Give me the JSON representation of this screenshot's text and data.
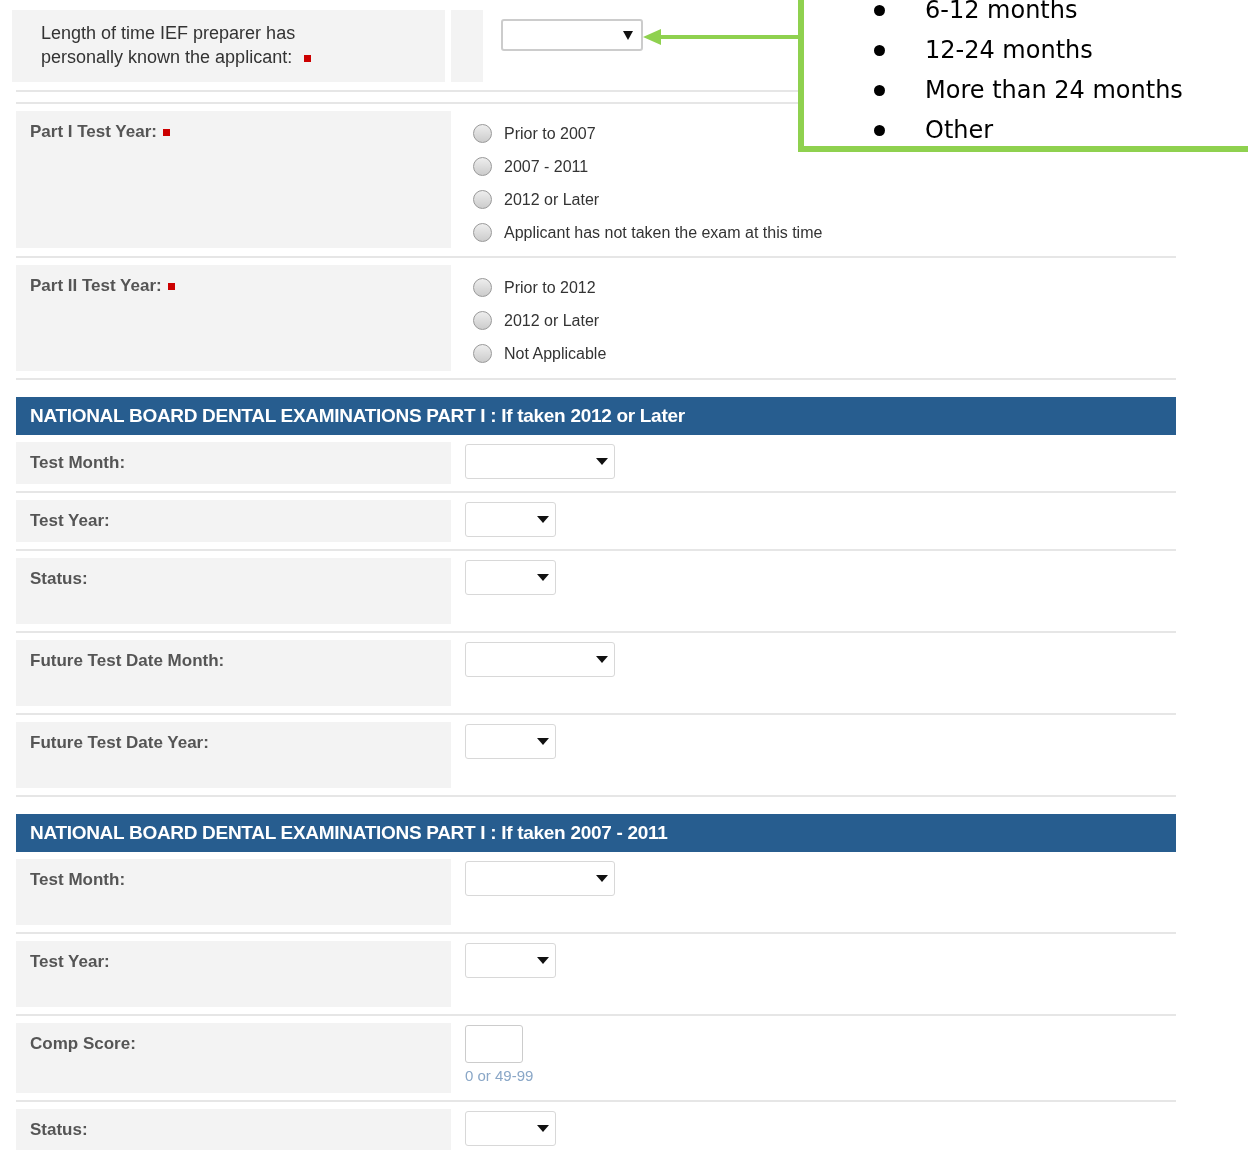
{
  "top_question": {
    "label": "Length of time IEF preparer has personally known the applicant:",
    "required": true
  },
  "callout": {
    "items": [
      "6-12 months",
      "12-24 months",
      "More than 24 months",
      "Other"
    ]
  },
  "rows": [
    {
      "kind": "radio",
      "label": "Part I Test Year:",
      "required": true,
      "options": [
        {
          "label": "Prior to 2007",
          "selected": false
        },
        {
          "label": "2007 - 2011",
          "selected": false
        },
        {
          "label": "2012 or Later",
          "selected": false
        },
        {
          "label": "Applicant has not taken the exam at this time",
          "selected": false
        }
      ]
    },
    {
      "kind": "radio",
      "label": "Part II Test Year:",
      "required": true,
      "options": [
        {
          "label": "Prior to 2012",
          "selected": false
        },
        {
          "label": "2012 or Later",
          "selected": false
        },
        {
          "label": "Not Applicable",
          "selected": false
        }
      ]
    },
    {
      "kind": "header",
      "label": "NATIONAL BOARD DENTAL EXAMINATIONS PART I : If taken 2012 or Later"
    },
    {
      "kind": "select",
      "label": "Test Month:",
      "wide": true
    },
    {
      "kind": "select",
      "label": "Test Year:",
      "wide": false
    },
    {
      "kind": "select",
      "label": "Status:",
      "wide": false
    },
    {
      "kind": "select",
      "label": "Future Test Date Month:",
      "wide": true
    },
    {
      "kind": "select",
      "label": "Future Test Date Year:",
      "wide": false
    },
    {
      "kind": "header",
      "label": "NATIONAL BOARD DENTAL EXAMINATIONS PART I : If taken 2007 - 2011"
    },
    {
      "kind": "select",
      "label": "Test Month:",
      "wide": true
    },
    {
      "kind": "select",
      "label": "Test Year:",
      "wide": false
    },
    {
      "kind": "number",
      "label": "Comp Score:",
      "hint": "0 or 49-99"
    },
    {
      "kind": "select",
      "label": "Status:",
      "wide": false
    }
  ]
}
